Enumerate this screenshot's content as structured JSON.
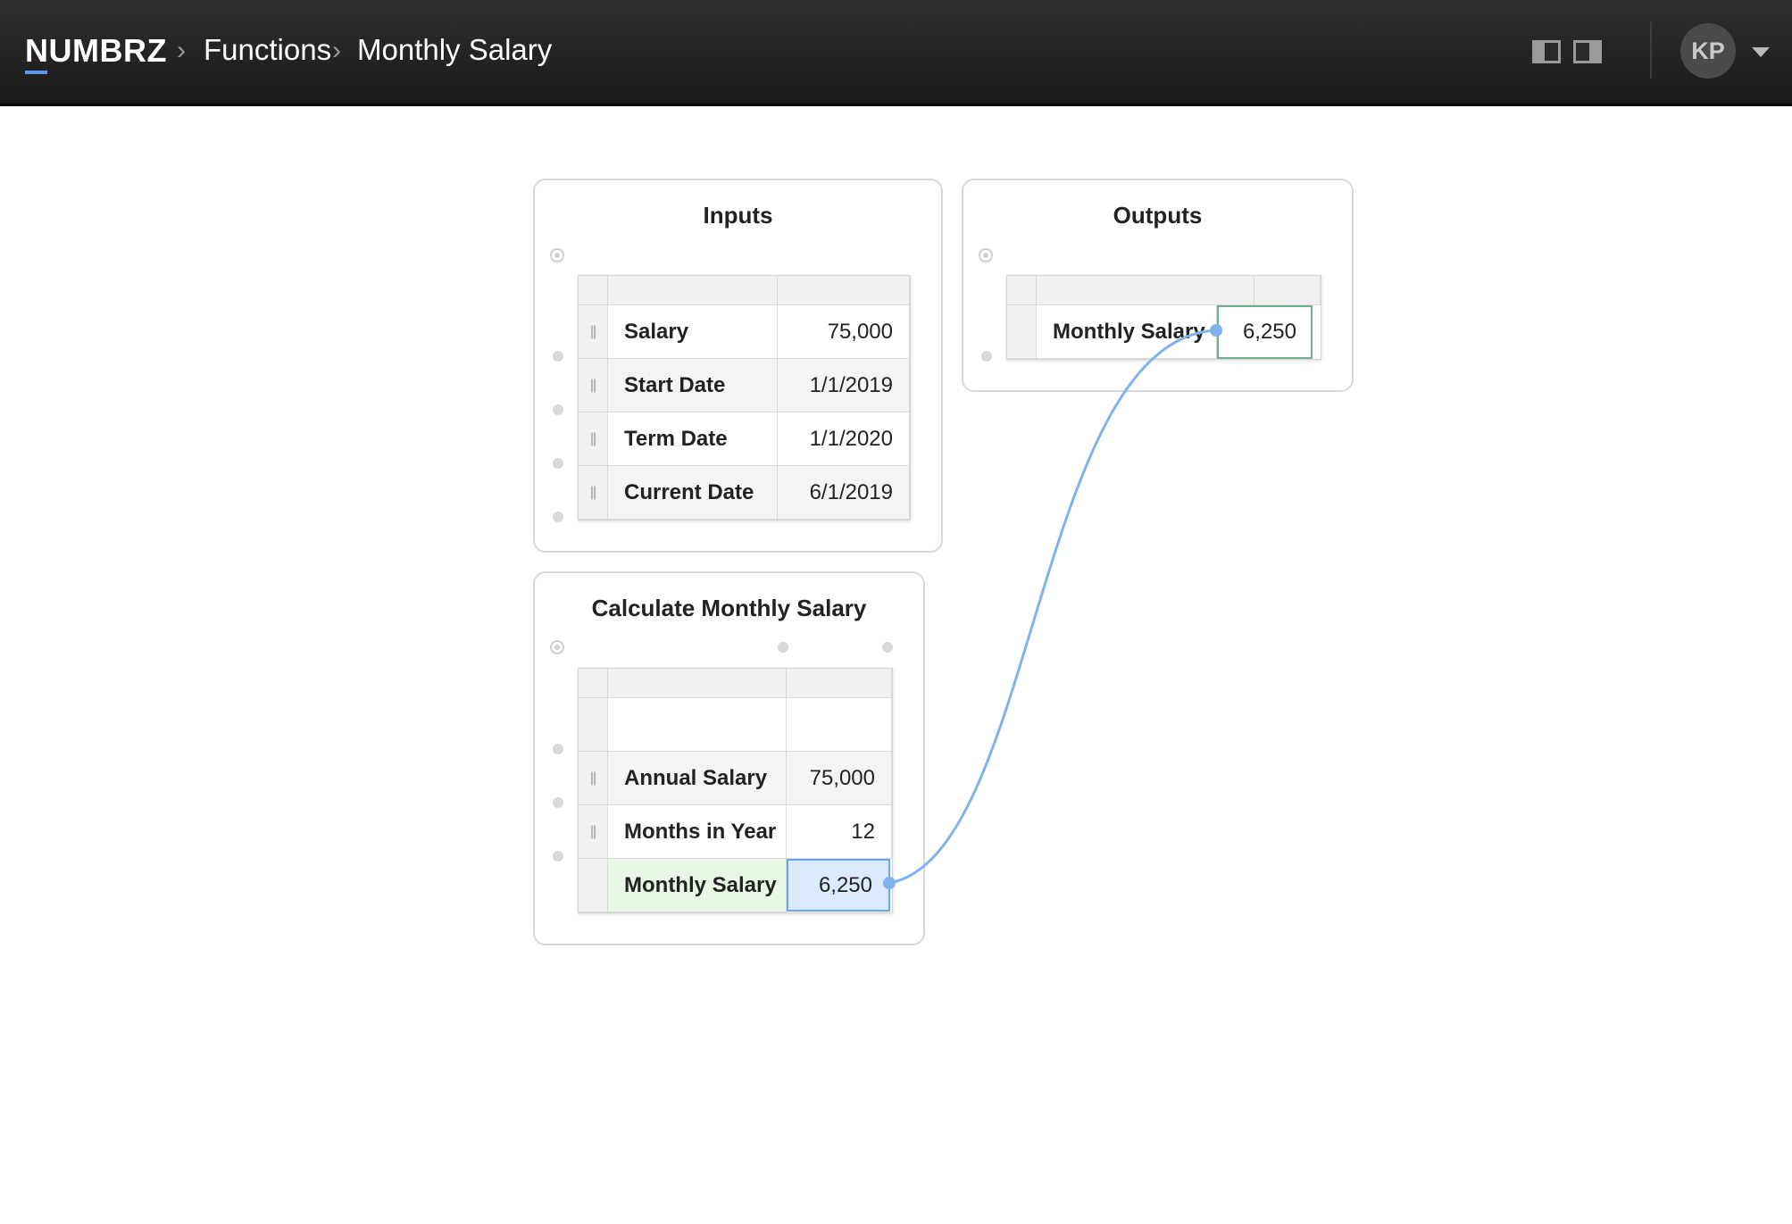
{
  "app": {
    "logo": "NUMBRZ",
    "breadcrumb": [
      "Functions",
      "Monthly Salary"
    ],
    "user_initials": "KP"
  },
  "icons": {
    "breadcrumb_separator": "chevron-right-icon",
    "layout_left": "layout-left-panel-icon",
    "layout_right": "layout-right-panel-icon",
    "user_menu": "caret-down-icon"
  },
  "colors": {
    "accent": "#5b9bf0",
    "connection": "#7fb3ee",
    "selected_cell": "#dbeaff",
    "result_row": "#e9f8e6",
    "output_border": "#6fae8e"
  },
  "inputs_block": {
    "title": "Inputs",
    "rows": [
      {
        "label": "Salary",
        "value": "75,000"
      },
      {
        "label": "Start Date",
        "value": "1/1/2019"
      },
      {
        "label": "Term Date",
        "value": "1/1/2020"
      },
      {
        "label": "Current Date",
        "value": "6/1/2019"
      }
    ]
  },
  "outputs_block": {
    "title": "Outputs",
    "rows": [
      {
        "label": "Monthly Salary",
        "value": "6,250"
      }
    ]
  },
  "calc_block": {
    "title": "Calculate Monthly Salary",
    "rows": [
      {
        "label": "",
        "value": ""
      },
      {
        "label": "Annual Salary",
        "value": "75,000"
      },
      {
        "label": "Months in Year",
        "value": "12"
      },
      {
        "label": "Monthly Salary",
        "value": "6,250"
      }
    ]
  }
}
